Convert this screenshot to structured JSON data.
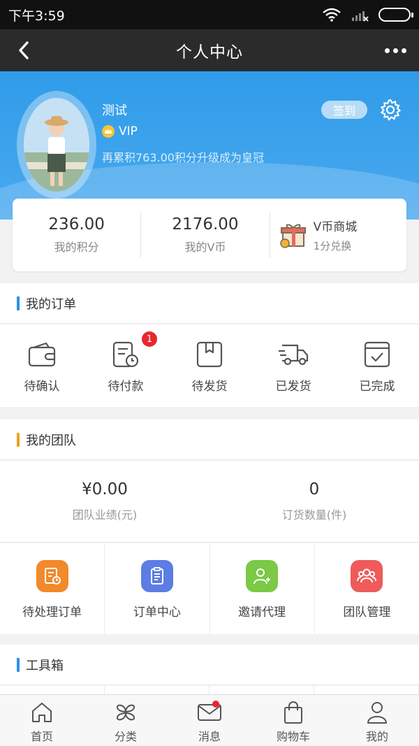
{
  "status_bar": {
    "time": "下午3:59"
  },
  "nav": {
    "title": "个人中心"
  },
  "profile": {
    "name": "测试",
    "level": "VIP",
    "upgrade_text": "再累积763.00积分升级成为皇冠",
    "checkin_label": "签到"
  },
  "points": {
    "points_value": "236.00",
    "points_label": "我的积分",
    "vcoin_value": "2176.00",
    "vcoin_label": "我的V币",
    "mall_title": "V币商城",
    "mall_sub": "1分兑换"
  },
  "orders": {
    "title": "我的订单",
    "items": [
      {
        "label": "待确认",
        "icon": "wallet-icon"
      },
      {
        "label": "待付款",
        "icon": "bill-clock-icon",
        "badge": "1"
      },
      {
        "label": "待发货",
        "icon": "box-icon"
      },
      {
        "label": "已发货",
        "icon": "truck-icon"
      },
      {
        "label": "已完成",
        "icon": "check-box-icon"
      }
    ]
  },
  "team": {
    "title": "我的团队",
    "performance_value": "¥0.00",
    "performance_label": "团队业绩(元)",
    "orders_value": "0",
    "orders_label": "订货数量(件)",
    "actions": [
      {
        "label": "待处理订单",
        "icon": "pending-order-icon",
        "color": "#f2892a"
      },
      {
        "label": "订单中心",
        "icon": "order-center-icon",
        "color": "#5c7de3"
      },
      {
        "label": "邀请代理",
        "icon": "invite-agent-icon",
        "color": "#7bc944"
      },
      {
        "label": "团队管理",
        "icon": "team-manage-icon",
        "color": "#ef5b5b"
      }
    ]
  },
  "tools": {
    "title": "工具箱"
  },
  "tab_bar": {
    "items": [
      {
        "label": "首页",
        "icon": "home-icon"
      },
      {
        "label": "分类",
        "icon": "category-icon"
      },
      {
        "label": "消息",
        "icon": "message-icon"
      },
      {
        "label": "购物车",
        "icon": "cart-icon"
      },
      {
        "label": "我的",
        "icon": "user-icon"
      }
    ]
  },
  "colors": {
    "header_blue": "#3aa2ec",
    "orders_bar": "#2e8fe8",
    "team_bar": "#f0a020",
    "tools_bar": "#2e8fe8",
    "badge_red": "#e8262d"
  }
}
